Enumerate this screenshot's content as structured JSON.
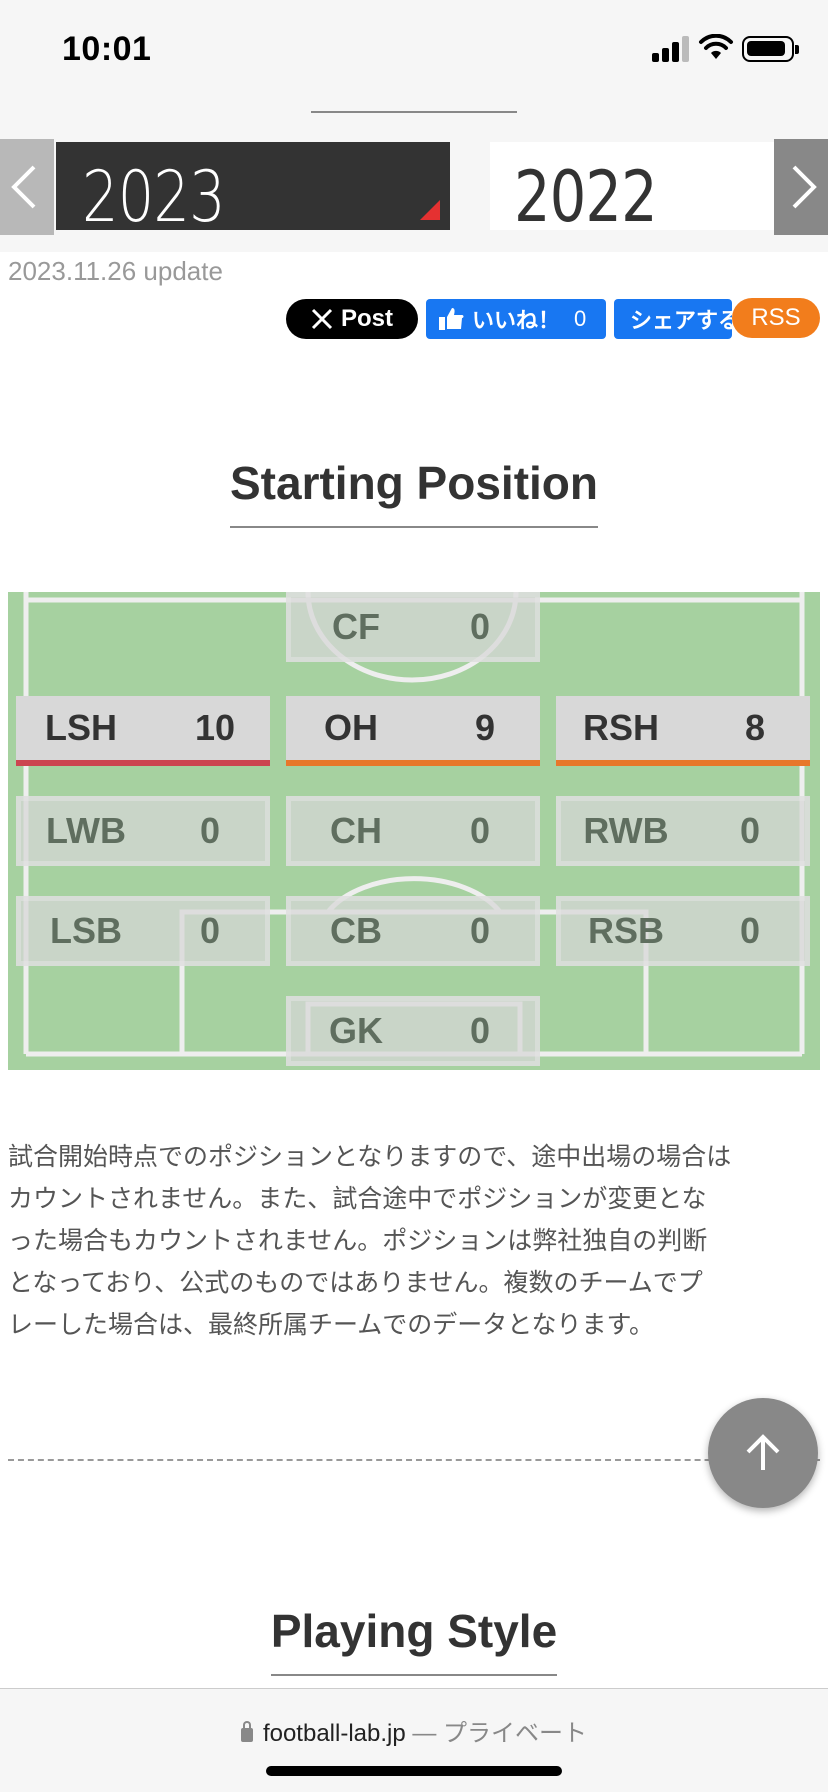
{
  "status_bar": {
    "time": "10:01"
  },
  "year_selector": {
    "current": "2023",
    "other": "2022"
  },
  "update_text": "2023.11.26 update",
  "social": {
    "x_post": "Post",
    "like": "いいね！",
    "like_count": "0",
    "share": "シェアする",
    "rss": "RSS"
  },
  "starting_position": {
    "title": "Starting Position",
    "positions": [
      {
        "name": "CF",
        "value": "0",
        "active": false
      },
      {
        "name": "LSH",
        "value": "10",
        "active": true,
        "color": "#cc4450"
      },
      {
        "name": "OH",
        "value": "9",
        "active": true,
        "color": "#e8772a"
      },
      {
        "name": "RSH",
        "value": "8",
        "active": true,
        "color": "#e8772a"
      },
      {
        "name": "LWB",
        "value": "0",
        "active": false
      },
      {
        "name": "CH",
        "value": "0",
        "active": false
      },
      {
        "name": "RWB",
        "value": "0",
        "active": false
      },
      {
        "name": "LSB",
        "value": "0",
        "active": false
      },
      {
        "name": "CB",
        "value": "0",
        "active": false
      },
      {
        "name": "RSB",
        "value": "0",
        "active": false
      },
      {
        "name": "GK",
        "value": "0",
        "active": false
      }
    ],
    "pitch_color": "#a6d1a0"
  },
  "description": {
    "line1": "試合開始時点でのポジションとなりますので、途中出場の場合は",
    "line2": "カウントされません。また、試合途中でポジションが変更とな",
    "line3": "った場合もカウントされません。ポジションは弊社独自の判断",
    "line4": "となっており、公式のものではありません。複数のチームでプ",
    "line5": "レーした場合は、最終所属チームでのデータとなります。"
  },
  "playing_style": {
    "title": "Playing Style"
  },
  "browser": {
    "domain": "football-lab.jp",
    "privacy": "— プライベート"
  },
  "icons": {
    "prev": "chevron-left-icon",
    "next": "chevron-right-icon",
    "scroll_top": "arrow-up-icon",
    "lock": "lock-icon",
    "wifi": "wifi-icon",
    "battery": "battery-icon",
    "signal": "signal-icon",
    "thumbs_up": "thumbs-up-icon",
    "x_logo": "x-logo-icon"
  }
}
